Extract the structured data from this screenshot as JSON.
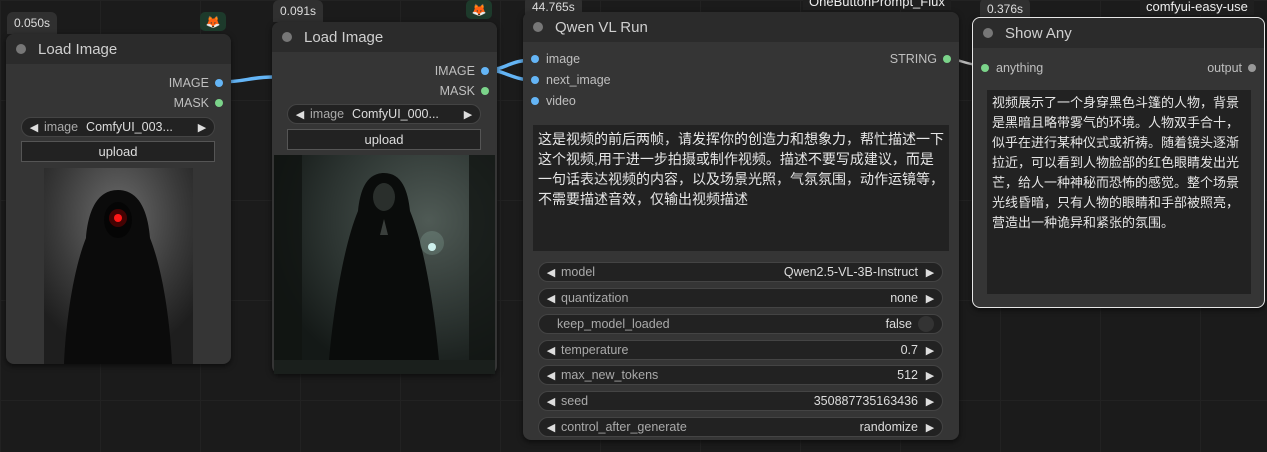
{
  "nodes": {
    "load_image_1": {
      "timer": "0.050s",
      "title": "Load Image",
      "outputs": [
        "IMAGE",
        "MASK"
      ],
      "image_widget": {
        "label": "image",
        "value": "ComfyUI_003..."
      },
      "upload_label": "upload"
    },
    "load_image_2": {
      "timer": "0.091s",
      "title": "Load Image",
      "outputs": [
        "IMAGE",
        "MASK"
      ],
      "image_widget": {
        "label": "image",
        "value": "ComfyUI_000..."
      },
      "upload_label": "upload"
    },
    "qwen": {
      "timer": "44.765s",
      "title": "Qwen VL Run",
      "inputs": [
        "image",
        "next_image",
        "video"
      ],
      "output": "STRING",
      "prompt": "这是视频的前后两帧，请发挥你的创造力和想象力，帮忙描述一下这个视频,用于进一步拍摄或制作视频。描述不要写成建议，而是一句话表达视频的内容，以及场景光照，气氛氛围，动作运镜等，不需要描述音效，仅输出视频描述",
      "widgets": [
        {
          "label": "model",
          "value": "Qwen2.5-VL-3B-Instruct",
          "kind": "combo"
        },
        {
          "label": "quantization",
          "value": "none",
          "kind": "combo"
        },
        {
          "label": "keep_model_loaded",
          "value": "false",
          "kind": "toggle"
        },
        {
          "label": "temperature",
          "value": "0.7",
          "kind": "number"
        },
        {
          "label": "max_new_tokens",
          "value": "512",
          "kind": "number"
        },
        {
          "label": "seed",
          "value": "350887735163436",
          "kind": "number"
        },
        {
          "label": "control_after_generate",
          "value": "randomize",
          "kind": "combo"
        }
      ]
    },
    "onebutton_tag": "OneButtonPrompt_Flux",
    "show_any": {
      "timer": "0.376s",
      "tag": "comfyui-easy-use",
      "title": "Show Any",
      "input": "anything",
      "output": "output",
      "text": "视频展示了一个身穿黑色斗篷的人物，背景是黑暗且略带雾气的环境。人物双手合十，似乎在进行某种仪式或祈祷。随着镜头逐渐拉近，可以看到人物脸部的红色眼睛发出光芒，给人一种神秘而恐怖的感觉。整个场景光线昏暗，只有人物的眼睛和手部被照亮，营造出一种诡异和紧张的氛围。"
    }
  },
  "colors": {
    "image_link": "#64b5f6",
    "string_link": "#7bd48a",
    "badge_icon": "#f29a38"
  },
  "icons": {
    "badge": "fox-icon",
    "arrow_left": "arrow-left-icon",
    "arrow_right": "arrow-right-icon"
  }
}
